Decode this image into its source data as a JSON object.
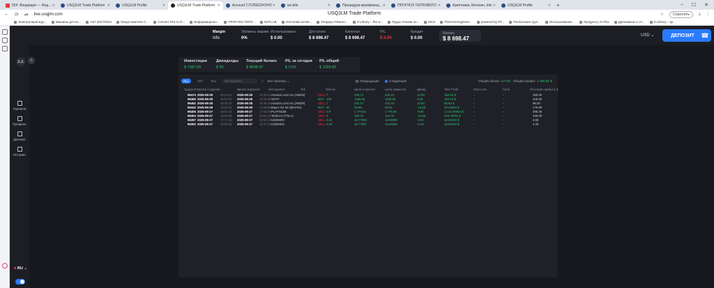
{
  "browser": {
    "tabs": [
      {
        "title": "524 ·Входящие — Яндекс",
        "icon": "mail-icon"
      },
      {
        "title": "USQJLM Trade Platform",
        "icon": "site-icon"
      },
      {
        "title": "USQJLM Profile",
        "icon": "site-icon"
      },
      {
        "title": "USQJLM Trade Platform",
        "icon": "github-icon",
        "active": true
      },
      {
        "title": "Account TJTZREGHOHO",
        "icon": "site-icon"
      },
      {
        "title": "wo.title",
        "icon": "site-icon"
      },
      {
        "title": "Процедура верификации",
        "icon": "site-icon"
      },
      {
        "title": "ПРОГНОЗ ТЕПЛОВОГО",
        "icon": "site-icon"
      },
      {
        "title": "Криптовая, Биткоин, bitc",
        "icon": "site-icon"
      },
      {
        "title": "USQJLM Profile",
        "icon": "site-icon"
      }
    ],
    "url": "live.usqjlm.com",
    "page_title": "USQJLM Trade Platform",
    "ask_label": "Спросить",
    "bookmarks": [
      "Электронный жур...",
      "Машины для вс...",
      "А67 3027/2024",
      "Представители С...",
      "Convert TEX to D...",
      "Информационн...",
      "ПРОГНОЗ ТЕПЛ...",
      "MATLAB",
      "memorials.tomsk...",
      "Тендеры Ремонт...",
      "Z-Library – the w...",
      "Труды Очкова по...",
      "MCS",
      "Thermal Engineer...",
      "powered by RT...",
      "Расписание груп...",
      "Использование...",
      "Продукты | K-Flex",
      "Дренажные и оч...",
      "Z-Library – кр..."
    ]
  },
  "header": {
    "margin_label": "Margin",
    "margin_value": "Info",
    "stats": [
      {
        "label": "Уровень маржи",
        "value": "0%"
      },
      {
        "label": "Использовано",
        "value": "$ 0.00"
      },
      {
        "label": "Доступно",
        "value": "$ 8 698.47"
      },
      {
        "label": "Капитал",
        "value": "$ 8 698.47"
      },
      {
        "label": "P/L",
        "value": "$ 0.00",
        "color": "#ee3333"
      },
      {
        "label": "Кредит",
        "value": "$ 0.00"
      }
    ],
    "balance_label": "Баланс",
    "balance_value": "$ 8 698.47",
    "currency": "USD",
    "deposit_label": "ДЕПОЗИТ"
  },
  "nav": {
    "avatar": "Д.Д.",
    "items": [
      {
        "label": "Торговля",
        "icon": "chart-icon"
      },
      {
        "label": "Профиль",
        "icon": "profile-icon"
      },
      {
        "label": "Депозит",
        "icon": "wallet-icon"
      },
      {
        "label": "История",
        "icon": "history-icon"
      }
    ],
    "language": "RU"
  },
  "summary": [
    {
      "label": "Инвестиции",
      "value": "$ 7387.65"
    },
    {
      "label": "Дивиденды",
      "value": "$ 50"
    },
    {
      "label": "Текущий баланс",
      "value": "$ 8698.47"
    },
    {
      "label": "P/L за сегодня",
      "value": "$ 0.00"
    },
    {
      "label": "P/L общий",
      "value": "$ 1360.82"
    }
  ],
  "filters": {
    "pills": [
      "ALL",
      "Sell",
      "Buy"
    ],
    "instrument_placeholder": "Инструмент",
    "all_brokers": "Все брокеры",
    "radio_pending": "Предыдущие",
    "radio_next": "Следующие",
    "total_volume_label": "Общий объем:",
    "total_volume_value": "147.08",
    "total_profit_label": "Общий профит:",
    "total_profit_value": "1 360.82 $"
  },
  "table": {
    "headers": [
      "Ордер ID",
      "Время создания",
      "Время закрытия",
      "Инструмент",
      "Тип",
      "Объем",
      "Цена открытия",
      "Цена закрытия",
      "Дивид",
      "Take Profit",
      "Stop Loss",
      "Своп",
      "Итоговая прибыль $"
    ],
    "rows": [
      [
        "96474",
        "2025-08-28",
        "16:34:24",
        "2025-08-28",
        "16:34:24",
        "Amazon.com Inc (AMZN)",
        "SELL",
        "7",
        "226.74",
        "226.10",
        "14.50",
        "150.83 $",
        "-",
        "-",
        "150.00"
      ],
      [
        "96455",
        "2025-08-28",
        "16:57:02",
        "2025-08-28",
        "17:11:58",
        "SOYF",
        "BUY",
        "100",
        "1186.96",
        "1186.96",
        "9.89",
        "100.00 $",
        "-",
        "-",
        "100.00"
      ],
      [
        "96452",
        "2025-08-28",
        "16:34:10",
        "2025-08-28",
        "16:36:18",
        "Amazon.com Inc (AMZN)",
        "SELL",
        "7",
        "233.17",
        "233.15",
        "14.50",
        "95.83 $",
        "-",
        "-",
        "95.00"
      ],
      [
        "96442",
        "2025-08-28",
        "14:53:03",
        "2025-08-28",
        "14:58:58",
        "Bayer AG NA (BAYGn)",
        "BUY",
        "90",
        "28.98",
        "28.91",
        "-14.50",
        "28.20003 $",
        "-",
        "-",
        "175.89"
      ],
      [
        "96405",
        "2025-08-27",
        "16:51:42",
        "2025-08-27",
        "17:05:45",
        "PLATINUM",
        "SELL",
        "0.9",
        "1 776.54",
        "1 776.60",
        "-9.80",
        "1 134.00003 $",
        "-",
        "-",
        "295.30"
      ],
      [
        "96404",
        "2025-08-27",
        "16:50:05",
        "2025-08-27",
        "16:51:43",
        "Tesla Inc (TSLA)",
        "SELL",
        "9",
        "183.76",
        "144.70",
        "-14.80",
        "224.70004 $",
        "-",
        "-",
        "430.00"
      ],
      [
        "96397",
        "2025-08-27",
        "17:17:32",
        "2025-08-27",
        "16:04:23",
        "USDMXN",
        "SELL",
        "0.02",
        "18.77000",
        "18.89000",
        "-0.02",
        "18.69330 $",
        "-",
        "-",
        "3.83"
      ],
      [
        "96392",
        "2025-08-27",
        "16:09:02",
        "2025-08-27",
        "16:37:32",
        "USDMXN",
        "SELL",
        "0.02",
        "18.77887",
        "18.69000",
        "-0.02",
        "18.69330 $",
        "-",
        "-",
        "4.29"
      ]
    ]
  },
  "colors": {
    "accent": "#2b7bff",
    "positive": "#2ec46d",
    "negative": "#ee3333",
    "background": "#17181d",
    "panel": "#202128"
  }
}
